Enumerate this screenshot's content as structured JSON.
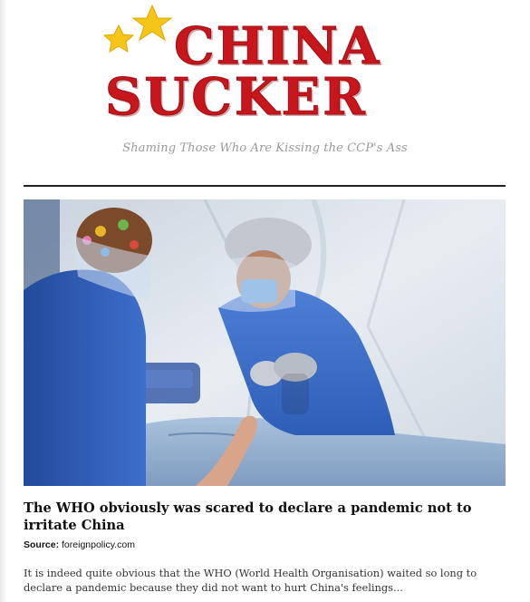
{
  "site": {
    "logo_line1": "CHINA",
    "logo_line2": "SUCKER",
    "logo_color": "#c8161d",
    "star_color": "#f5c518",
    "tagline": "Shaming Those Who Are Kissing the CCP's Ass"
  },
  "article": {
    "image_alt": "photo-healthcare-workers",
    "title": "The WHO obviously was scared to declare a pandemic not to irritate China",
    "source_label": "Source:",
    "source_value": "foreignpolicy.com",
    "excerpt": "It is indeed quite obvious that the WHO (World Health Organisation) waited so long to declare a pandemic because they did not want to hurt China's feelings..."
  }
}
